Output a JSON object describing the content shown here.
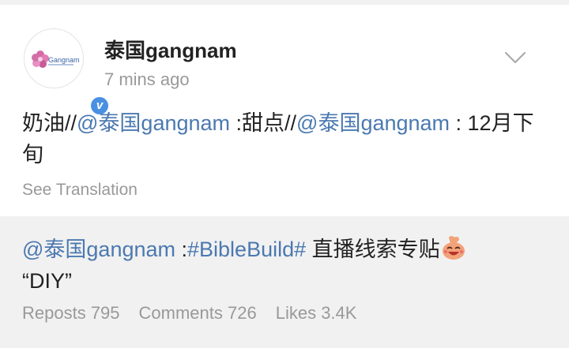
{
  "post": {
    "username": "泰国gangnam",
    "time": "7  mins ago",
    "content": {
      "t1": "奶油//",
      "m1": "@泰国gangnam",
      "t2": " :甜点//",
      "m2": "@泰国gangnam",
      "t3": " : 12月下旬"
    },
    "see_translation": "See Translation"
  },
  "avatar": {
    "logo_text": "Gangnam"
  },
  "repost": {
    "mention": "@泰国gangnam",
    "sep": " :",
    "hashtag": "#BibleBuild#",
    "text": " 直播线索专贴",
    "line2": "“DIY”",
    "stats": {
      "reposts": "Reposts 795",
      "comments": "Comments 726",
      "likes": "Likes 3.4K"
    }
  },
  "icons": {
    "chevron": "chevron-down-icon",
    "verified": "verified-badge-icon",
    "emoji": "laughing-emoji-icon"
  },
  "colors": {
    "link": "#4b79b0",
    "verified": "#4a90e2",
    "meta": "#999999",
    "repost_bg": "#f1f1f1"
  }
}
